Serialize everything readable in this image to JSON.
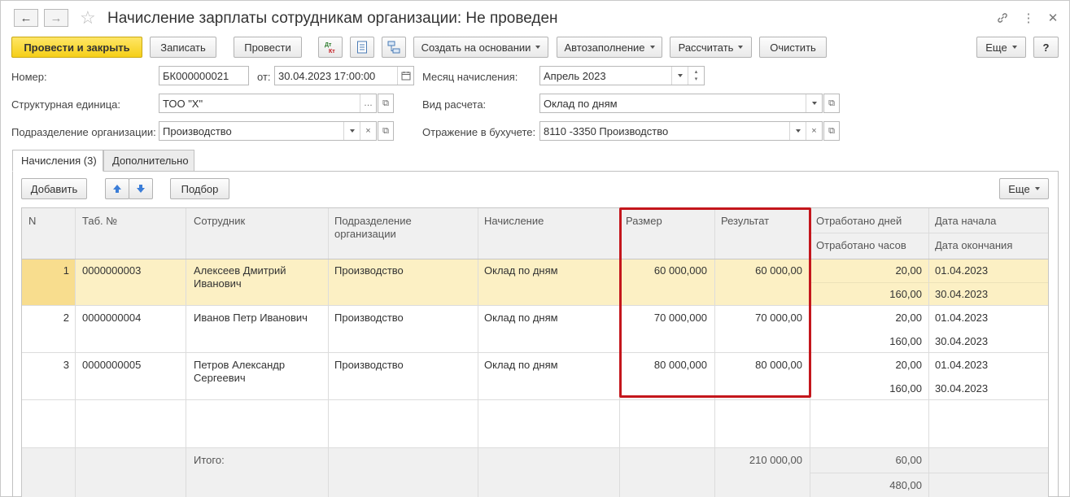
{
  "window": {
    "title": "Начисление зарплаты сотрудникам организации: Не проведен"
  },
  "toolbar": {
    "post_close": "Провести и закрыть",
    "save": "Записать",
    "post": "Провести",
    "dt_kt_icon": "Дт Кт",
    "create_based": "Создать на основании",
    "autofill": "Автозаполнение",
    "calculate": "Рассчитать",
    "clear": "Очистить",
    "more": "Еще",
    "help": "?"
  },
  "form": {
    "number_label": "Номер:",
    "number_value": "БК000000021",
    "date_label": "от:",
    "date_value": "30.04.2023 17:00:00",
    "month_label": "Месяц начисления:",
    "month_value": "Апрель 2023",
    "unit_label": "Структурная единица:",
    "unit_value": "ТОО \"Х\"",
    "calc_type_label": "Вид расчета:",
    "calc_type_value": "Оклад по дням",
    "dept_label": "Подразделение организации:",
    "dept_value": "Производство",
    "accounting_label": "Отражение в бухучете:",
    "accounting_value": "8110 -3350 Производство"
  },
  "tabs": [
    {
      "label": "Начисления (3)"
    },
    {
      "label": "Дополнительно"
    }
  ],
  "table_toolbar": {
    "add": "Добавить",
    "pick": "Подбор",
    "more": "Еще"
  },
  "table": {
    "headers": {
      "n": "N",
      "tab_no": "Таб. №",
      "employee": "Сотрудник",
      "dept": "Подразделение организации",
      "accrual": "Начисление",
      "size": "Размер",
      "result": "Результат",
      "days": "Отработано дней",
      "hours": "Отработано часов",
      "start": "Дата начала",
      "end": "Дата окончания"
    },
    "rows": [
      {
        "n": "1",
        "tab_no": "0000000003",
        "employee_1": "Алексеев Дмитрий",
        "employee_2": "Иванович",
        "dept": "Производство",
        "accrual": "Оклад по дням",
        "size": "60 000,000",
        "result": "60 000,00",
        "days": "20,00",
        "hours": "160,00",
        "start": "01.04.2023",
        "end": "30.04.2023"
      },
      {
        "n": "2",
        "tab_no": "0000000004",
        "employee_1": "Иванов Петр Иванович",
        "employee_2": "",
        "dept": "Производство",
        "accrual": "Оклад по дням",
        "size": "70 000,000",
        "result": "70 000,00",
        "days": "20,00",
        "hours": "160,00",
        "start": "01.04.2023",
        "end": "30.04.2023"
      },
      {
        "n": "3",
        "tab_no": "0000000005",
        "employee_1": "Петров Александр",
        "employee_2": "Сергеевич",
        "dept": "Производство",
        "accrual": "Оклад по дням",
        "size": "80 000,000",
        "result": "80 000,00",
        "days": "20,00",
        "hours": "160,00",
        "start": "01.04.2023",
        "end": "30.04.2023"
      }
    ],
    "footer": {
      "label": "Итого:",
      "result": "210 000,00",
      "days": "60,00",
      "hours": "480,00"
    }
  },
  "colors": {
    "accent_yellow": "#f5cf18",
    "selected_row": "#fcf0c4",
    "selected_n": "#f8dd8e",
    "highlight_box": "#c4161c"
  }
}
